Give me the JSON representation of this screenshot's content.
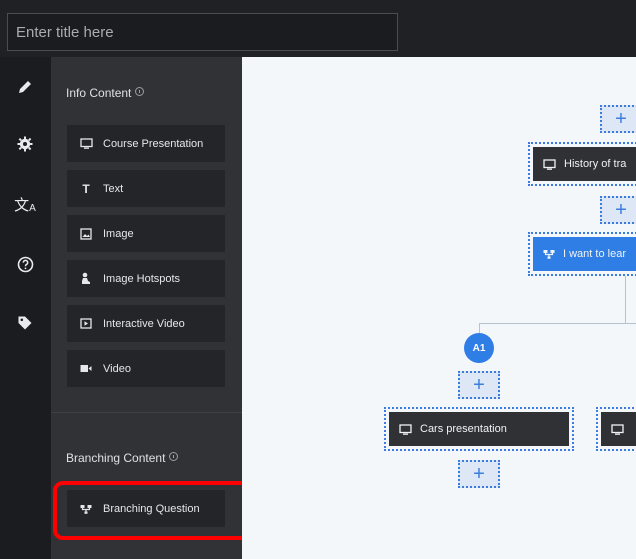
{
  "header": {
    "title_placeholder": "Enter title here"
  },
  "rail": {
    "icons": [
      "pencil-icon",
      "gear-icon",
      "translate-icon",
      "help-icon",
      "tag-icon"
    ]
  },
  "panel": {
    "info_section_title": "Info Content",
    "info_items": [
      {
        "label": "Course Presentation",
        "icon": "presentation-icon"
      },
      {
        "label": "Text",
        "icon": "text-icon"
      },
      {
        "label": "Image",
        "icon": "image-icon"
      },
      {
        "label": "Image Hotspots",
        "icon": "hotspot-icon"
      },
      {
        "label": "Interactive Video",
        "icon": "interactive-video-icon"
      },
      {
        "label": "Video",
        "icon": "video-icon"
      }
    ],
    "branching_section_title": "Branching Content",
    "branching_items": [
      {
        "label": "Branching Question",
        "icon": "branching-icon"
      }
    ],
    "highlight_color": "#ff0000"
  },
  "canvas": {
    "nodes": [
      {
        "label": "History of tra",
        "icon": "presentation-icon"
      },
      {
        "label": "I want to lear",
        "icon": "branching-icon",
        "color": "#2f7ee6"
      },
      {
        "label": "Cars presentation",
        "icon": "presentation-icon"
      },
      {
        "label": "",
        "icon": "presentation-icon"
      }
    ],
    "badge": "A1",
    "plus_label": "+"
  },
  "colors": {
    "accent": "#2f7ee6",
    "dark_bg": "#202124",
    "panel_bg": "#303236"
  }
}
